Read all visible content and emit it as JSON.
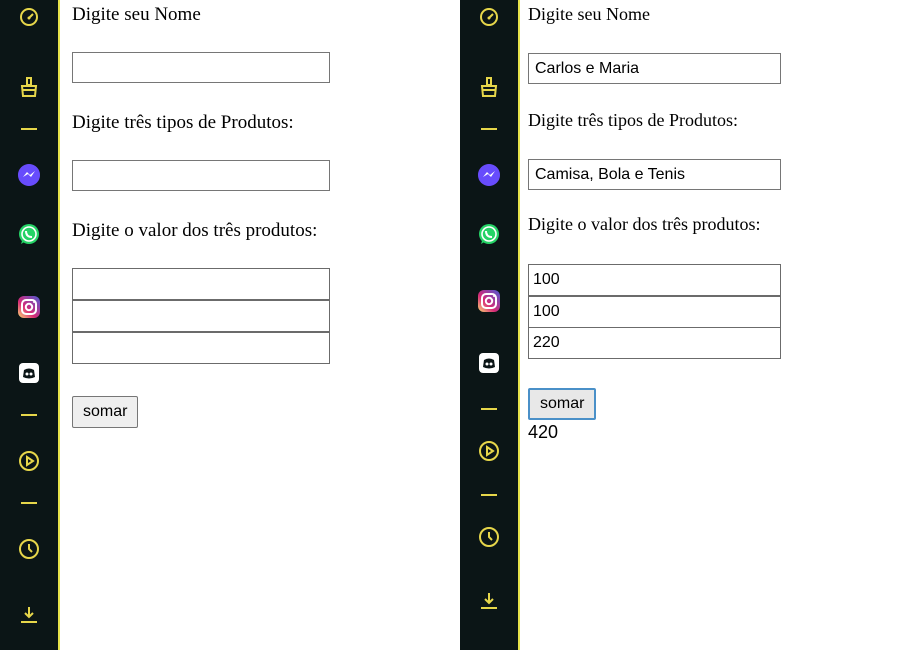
{
  "colors": {
    "sidebar_bg": "#0b1516",
    "sidebar_border": "#e6e24a",
    "accent_yellow": "#e6d64a",
    "messenger": "#a334fa",
    "whatsapp": "#25d366",
    "instagram": "#e1306c",
    "button_focus": "#4a90c8"
  },
  "sidebar": {
    "icons": [
      "speedometer-icon",
      "broom-icon",
      "messenger-icon",
      "whatsapp-icon",
      "instagram-icon",
      "discord-icon",
      "play-circle-icon",
      "clock-icon",
      "download-icon"
    ]
  },
  "form_empty": {
    "name_label": "Digite seu Nome",
    "name_value": "",
    "products_label": "Digite três tipos de Produtos:",
    "products_value": "",
    "values_label": "Digite o valor dos três produtos:",
    "value1": "",
    "value2": "",
    "value3": "",
    "button_label": "somar",
    "result": ""
  },
  "form_filled": {
    "name_label": "Digite seu Nome",
    "name_value": "Carlos e Maria",
    "products_label": "Digite três tipos de Produtos:",
    "products_value": "Camisa, Bola e Tenis",
    "values_label": "Digite o valor dos três produtos:",
    "value1": "100",
    "value2": "100",
    "value3": "220",
    "button_label": "somar",
    "result": "420"
  }
}
